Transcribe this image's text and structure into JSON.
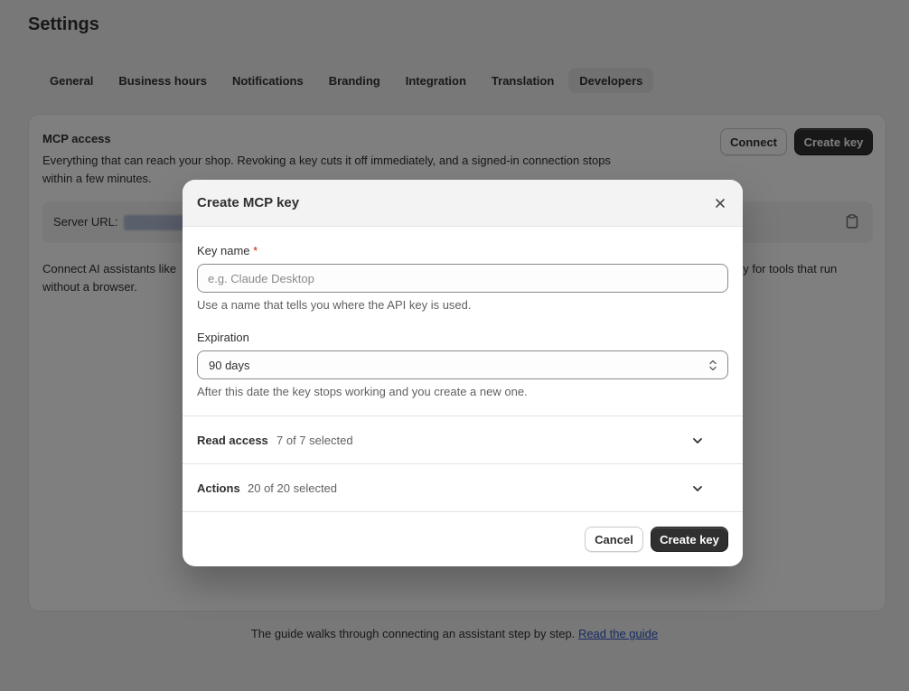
{
  "page": {
    "title": "Settings"
  },
  "tabs": [
    {
      "label": "General"
    },
    {
      "label": "Business hours"
    },
    {
      "label": "Notifications"
    },
    {
      "label": "Branding"
    },
    {
      "label": "Integration"
    },
    {
      "label": "Translation"
    },
    {
      "label": "Developers",
      "active": true
    }
  ],
  "mcp": {
    "title": "MCP access",
    "description": "Everything that can reach your shop. Revoking a key cuts it off immediately, and a signed-in connection stops within a few minutes.",
    "connect_label": "Connect",
    "create_key_label": "Create key",
    "server_url_label": "Server URL:",
    "connect_text_left_line1": "Connect AI assistants like",
    "connect_text_left_line2": "without a browser.",
    "connect_text_right": "ey for tools that run"
  },
  "guide": {
    "text": "The guide walks through connecting an assistant step by step.",
    "link_label": "Read the guide"
  },
  "modal": {
    "title": "Create MCP key",
    "key_name_label": "Key name",
    "required_mark": "*",
    "key_name_placeholder": "e.g. Claude Desktop",
    "key_name_value": "",
    "key_name_help": "Use a name that tells you where the API key is used.",
    "expiration_label": "Expiration",
    "expiration_value": "90 days",
    "expiration_help": "After this date the key stops working and you create a new one.",
    "read_access_title": "Read access",
    "read_access_count": "7 of 7 selected",
    "actions_title": "Actions",
    "actions_count": "20 of 20 selected",
    "cancel_label": "Cancel",
    "create_label": "Create key"
  },
  "colors": {
    "primary_button": "#303030",
    "link": "#2c56c8",
    "required": "#c5280c",
    "overlay": "rgba(0,0,0,0.5)"
  },
  "icons": {
    "close": "close-icon",
    "clipboard": "clipboard-icon",
    "chevron": "chevron-down-icon",
    "select": "select-arrows-icon"
  }
}
